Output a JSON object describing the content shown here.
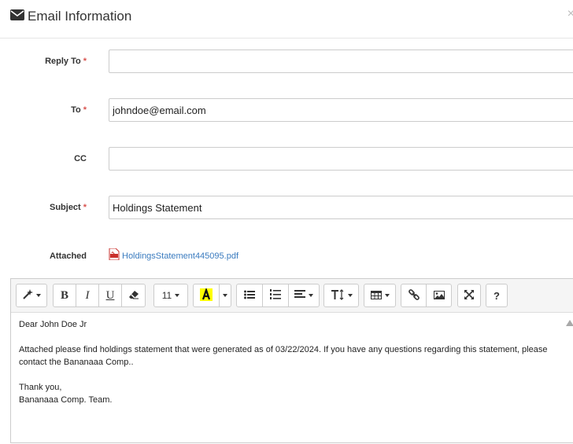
{
  "modal": {
    "title": "Email Information",
    "close_glyph": "×"
  },
  "form": {
    "reply_to": {
      "label": "Reply To",
      "required": "*",
      "value": ""
    },
    "to": {
      "label": "To",
      "required": "*",
      "value": "johndoe@email.com"
    },
    "cc": {
      "label": "CC",
      "value": ""
    },
    "subject": {
      "label": "Subject",
      "required": "*",
      "value": "Holdings Statement"
    },
    "attached": {
      "label": "Attached",
      "file_name": "HoldingsStatement445095.pdf",
      "icon": "pdf-icon"
    }
  },
  "toolbar": {
    "font_size": "11",
    "bold": "B",
    "italic": "I",
    "underline": "U",
    "help": "?",
    "highlight_color": "#ffff00"
  },
  "body": {
    "greeting": "Dear John Doe Jr",
    "paragraph1": "Attached please find holdings statement that were generated as of 03/22/2024. If you have any questions regarding this statement, please contact the Bananaaa Comp..",
    "closing": "Thank you,",
    "signature": "Bananaaa Comp. Team."
  }
}
